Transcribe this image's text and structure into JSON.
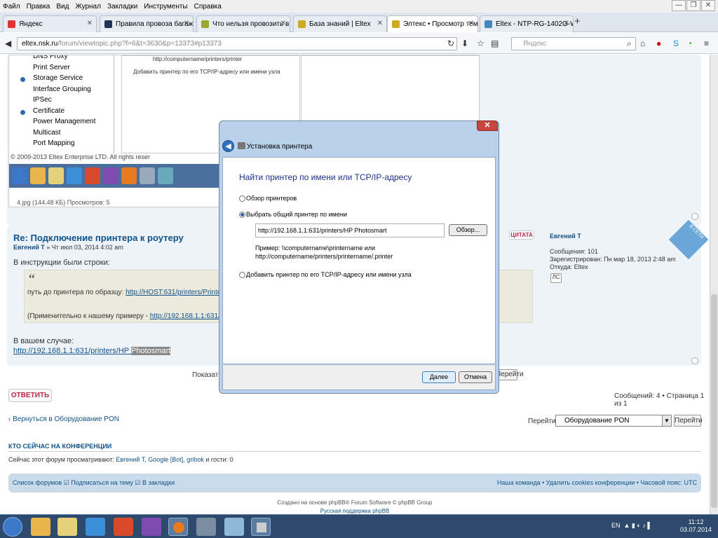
{
  "menubar": [
    "Файл",
    "Правка",
    "Вид",
    "Журнал",
    "Закладки",
    "Инструменты",
    "Справка"
  ],
  "tabs": [
    {
      "label": "Яндекс",
      "color": "#d33"
    },
    {
      "label": "Правила провоза багажа ...",
      "color": "#235"
    },
    {
      "label": "Что нельзя провозить в с...",
      "color": "#9a3"
    },
    {
      "label": "База знаний | Eltex",
      "color": "#ca2"
    },
    {
      "label": "Элтекс • Просмотр темы ...",
      "color": "#ca2"
    },
    {
      "label": "Eltex - NTP-RG-1402G-W",
      "color": "#48b"
    }
  ],
  "url": {
    "domain": "eltex.nsk.ru",
    "path": "/forum/viewtopic.php?f=6&t=3630&p=13373#p13373"
  },
  "search_placeholder": "Яндекс",
  "tree_items": [
    "DNS Proxy",
    "Print Server",
    "Storage Service",
    "Interface Grouping",
    "IPSec",
    "Certificate",
    "Power Management",
    "Multicast",
    "Port Mapping"
  ],
  "shot": {
    "inner_line1": "http://computername/printers/printer",
    "inner_line2": "Добавить принтер по его TCP/IP-адресу или имени узла",
    "copyright": "© 2009-2013 Eltex Enterprise LTD. All rights reser",
    "imginfo": "4.jpg (144.48 КБ) Просмотров: 5"
  },
  "post": {
    "title": "Re: Подключение принтера к роутеру",
    "author": "Евгений Т",
    "date": " » Чт июл 03, 2014 4:02 am",
    "intro": "В инструкции были строки:",
    "quote_prefix1": "путь до принтера по образцу: ",
    "quote_link1": "http://HOST:631/printers/Printer_Name",
    "quote_prefix2": "(Применительно к нашему примеру - ",
    "quote_link2": "http://192.168.1.1:631/printers/Printer",
    "case_label": "В вашем случае:",
    "case_link": "http://192.168.1.1:631/printers/HP ",
    "case_sel": "Photosmart",
    "quote_button": "ЦИТАТА"
  },
  "profile": {
    "name": "Евгений Т",
    "msgs": "Сообщения: 101",
    "reg": "Зарегистрирован: Пн мар 18, 2013 2:48 am",
    "from": "Откуда: Eltex",
    "pm": "ЛС",
    "online": "В СЕТИ"
  },
  "show_label": "Показать",
  "go_label": "Перейти",
  "reply_label": "ОТВЕТИТЬ",
  "pagination": "Сообщений: 4 • Страница 1 из 1",
  "back_link": "Вернуться в Оборудование PON",
  "jump_label": "Перейти:",
  "jump_value": "Оборудование PON",
  "jump_button": "Перейти",
  "who_head": "КТО СЕЙЧАС НА КОНФЕРЕНЦИИ",
  "who_text": "Сейчас этот форум просматривают: ",
  "who_users": "Евгений Т, Google [Bot], gribok",
  "who_tail": " и гости: 0",
  "footer_left": "Список форумов  ☑ Подписаться на тему  ☑ В закладки",
  "footer_right": "Наша команда • Удалить cookies конференции • Часовой пояс: UTC",
  "credits1": "Создано на основе phpBB® Forum Software © phpBB Group",
  "credits2": "Русская поддержка phpBB",
  "dialog": {
    "title": "Установка принтера",
    "heading": "Найти принтер по имени или TCP/IP-адресу",
    "opt1": "Обзор принтеров",
    "opt2": "Выбрать общий принтер по имени",
    "input": "http://192.168.1.1:631/printers/HP Photosmart",
    "browse": "Обзор...",
    "example1": "Пример: \\\\computername\\printername или",
    "example2": "http://computername/printers/printername/.printer",
    "opt3": "Добавить принтер по его TCP/IP-адресу или имени узла",
    "next": "Далее",
    "cancel": "Отмена"
  },
  "tray": {
    "lang": "EN",
    "time": "11:12",
    "date": "03.07.2014"
  }
}
